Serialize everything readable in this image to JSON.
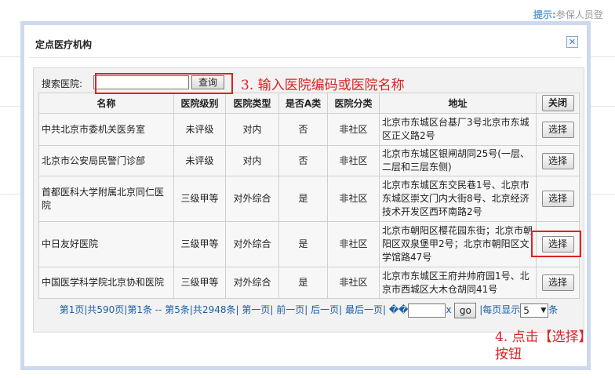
{
  "background": {
    "hint_key": "提示:",
    "hint_text": "参保人员登"
  },
  "dialog": {
    "title": "定点医疗机构",
    "close_icon": "close-icon"
  },
  "search": {
    "label": "搜索医院:",
    "value": "",
    "button": "查询"
  },
  "annotation1": "3. 输入医院编码或医院名称",
  "annotation2_line1": "4. 点击【选择】",
  "annotation2_line2": "按钮",
  "table": {
    "columns": [
      "名称",
      "医院级别",
      "医院类型",
      "是否A类",
      "医院分类",
      "地址",
      "关闭"
    ],
    "rows": [
      {
        "name": "中共北京市委机关医务室",
        "level": "未评级",
        "type": "对内",
        "is_a": "否",
        "category": "非社区",
        "address": "北京市东城区台基厂3号北京市东城区正义路2号",
        "action": "选择"
      },
      {
        "name": "北京市公安局民警门诊部",
        "level": "未评级",
        "type": "对内",
        "is_a": "否",
        "category": "非社区",
        "address": "北京市东城区银闸胡同25号(一层、二层和三层东侧)",
        "action": "选择"
      },
      {
        "name": "首都医科大学附属北京同仁医院",
        "level": "三级甲等",
        "type": "对外综合",
        "is_a": "是",
        "category": "非社区",
        "address": "北京市东城区东交民巷1号、北京市东城区崇文门内大街8号、北京经济技术开发区西环南路2号",
        "action": "选择"
      },
      {
        "name": "中日友好医院",
        "level": "三级甲等",
        "type": "对外综合",
        "is_a": "是",
        "category": "非社区",
        "address": "北京市朝阳区樱花园东街；北京市朝阳区双泉堡甲2号；北京市朝阳区文学馆路47号",
        "action": "选择"
      },
      {
        "name": "中国医学科学院北京协和医院",
        "level": "三级甲等",
        "type": "对外综合",
        "is_a": "是",
        "category": "非社区",
        "address": "北京市东城区王府井帅府园1号、北京市西城区大木仓胡同41号",
        "action": "选择"
      }
    ]
  },
  "pager": {
    "summary": "第1页|共590页|第1条 -- 第5条|共2948条|",
    "first": "第一页",
    "prev": "前一页",
    "next": "后一页",
    "last": "最后一页",
    "garbled": "��",
    "goto_suffix": "x",
    "go": "go",
    "per_page_prefix": "|每页显示",
    "per_page_value": "5",
    "per_page_suffix": "条"
  }
}
